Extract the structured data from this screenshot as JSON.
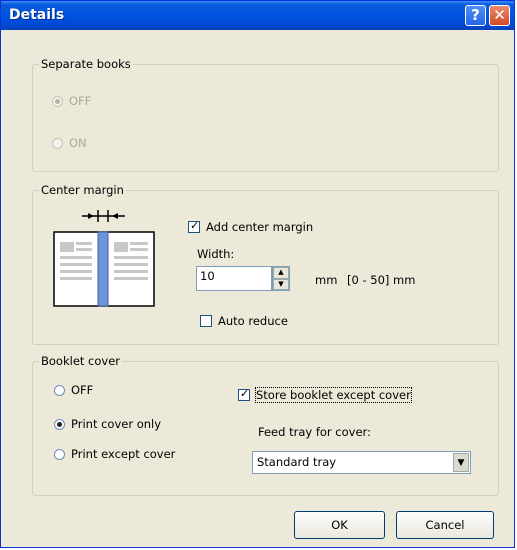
{
  "window": {
    "title": "Details",
    "help_button": "?",
    "close_button": "✕"
  },
  "separate_books": {
    "legend": "Separate books",
    "options": [
      "OFF",
      "ON"
    ],
    "selected": "OFF",
    "disabled": true
  },
  "center_margin": {
    "legend": "Center margin",
    "add_center_margin_label": "Add center margin",
    "add_center_margin_checked": true,
    "width_label": "Width:",
    "width_value": "10",
    "unit": "mm",
    "range": "[0 - 50] mm",
    "auto_reduce_label": "Auto reduce",
    "auto_reduce_checked": false
  },
  "booklet_cover": {
    "legend": "Booklet cover",
    "options": [
      "OFF",
      "Print cover only",
      "Print except cover"
    ],
    "selected": "Print cover only",
    "store_booklet_label": "Store booklet except cover",
    "store_booklet_checked": true,
    "feed_tray_label": "Feed tray for cover:",
    "feed_tray_value": "Standard tray"
  },
  "buttons": {
    "ok": "OK",
    "cancel": "Cancel"
  },
  "icons": {
    "help": "help-icon",
    "close": "close-icon",
    "booklet": "booklet-center-margin-icon"
  },
  "colors": {
    "titlebar": "#0054e3",
    "dialog_bg": "#ece9d8",
    "accent": "#3b7ddd"
  }
}
